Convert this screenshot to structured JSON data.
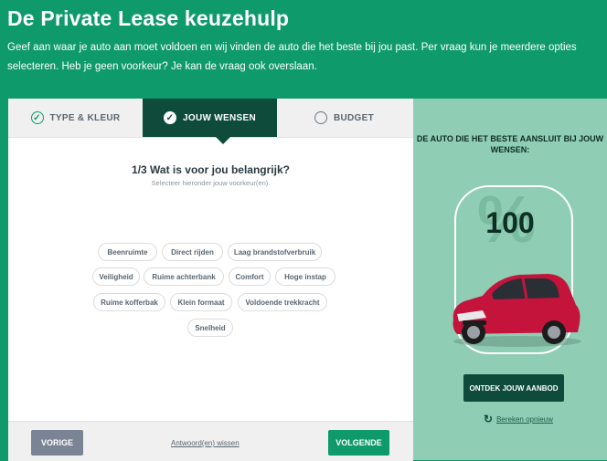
{
  "header": {
    "title": "De Private Lease keuzehulp",
    "intro": "Geef aan waar je auto aan moet voldoen en wij vinden de auto die het beste bij jou past. Per vraag kun je meerdere opties selecteren. Heb je geen voorkeur? Je kan de vraag ook overslaan."
  },
  "tabs": [
    {
      "label": "TYPE & KLEUR",
      "state": "done"
    },
    {
      "label": "JOUW WENSEN",
      "state": "active"
    },
    {
      "label": "BUDGET",
      "state": "todo"
    }
  ],
  "question": {
    "title": "1/3 Wat is voor jou belangrijk?",
    "subtitle": "Selecteer hieronder jouw voorkeur(en)."
  },
  "options": [
    "Beenruimte",
    "Direct rijden",
    "Laag brandstofverbruik",
    "Veiligheid",
    "Ruime achterbank",
    "Comfort",
    "Hoge instap",
    "Ruime kofferbak",
    "Klein formaat",
    "Voldoende trekkracht",
    "Snelheid"
  ],
  "footer": {
    "prev_label": "VORIGE",
    "reset_label": "Antwoord(en) wissen",
    "next_label": "VOLGENDE"
  },
  "side": {
    "title": "DE AUTO DIE HET BESTE AANSLUIT BIJ JOUW WENSEN:",
    "percent_symbol": "%",
    "score": "100",
    "offer_label": "ONTDEK JOUW AANBOD",
    "recalc_label": "Bereken opnieuw",
    "car_color": "#c4143c"
  },
  "colors": {
    "brand_green": "#0f9a6c",
    "dark_green": "#0e4b3b",
    "side_green": "#8fcdb4"
  }
}
